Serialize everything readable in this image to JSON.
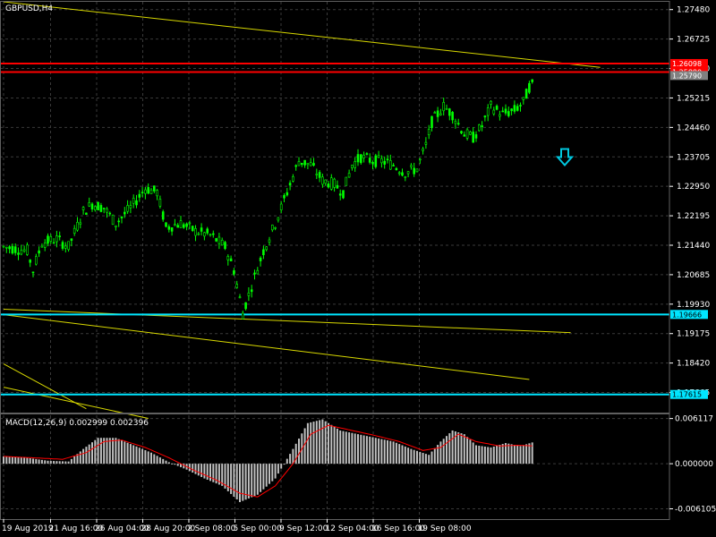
{
  "header": {
    "symbol": "GBPUSD,H4"
  },
  "macd_header": {
    "text": "MACD(12,26,9) 0.002999 0.002396"
  },
  "colors": {
    "background": "#000000",
    "grid": "#3a3a3a",
    "candles": "#00ff00",
    "trendline": "#d8d800",
    "resistance": "#ff0000",
    "support": "#00e5ff",
    "macd_hist": "#c0c0c0",
    "macd_signal": "#ff0000",
    "arrow": "#00c8e0"
  },
  "chart_data": [
    {
      "type": "line",
      "title": "GBPUSD,H4",
      "y_ticks": [
        "1.27480",
        "1.26725",
        "1.25970",
        "1.25215",
        "1.24460",
        "1.23705",
        "1.22950",
        "1.22195",
        "1.21440",
        "1.20685",
        "1.19930",
        "1.19175",
        "1.18420",
        "1.17665"
      ],
      "ylim": [
        1.1715,
        1.2768
      ],
      "x_ticks": [
        "19 Aug 2019",
        "21 Aug 16:00",
        "26 Aug 04:00",
        "28 Aug 20:00",
        "2 Sep 08:00",
        "5 Sep 00:00",
        "9 Sep 12:00",
        "12 Sep 04:00",
        "16 Sep 16:00",
        "19 Sep 08:00"
      ],
      "bars_total": 180,
      "price_path": [
        [
          0,
          1.214
        ],
        [
          8,
          1.213
        ],
        [
          10,
          1.208
        ],
        [
          13,
          1.215
        ],
        [
          18,
          1.216
        ],
        [
          22,
          1.214
        ],
        [
          27,
          1.223
        ],
        [
          30,
          1.225
        ],
        [
          34,
          1.224
        ],
        [
          38,
          1.22
        ],
        [
          43,
          1.224
        ],
        [
          48,
          1.229
        ],
        [
          52,
          1.228
        ],
        [
          55,
          1.219
        ],
        [
          60,
          1.22
        ],
        [
          65,
          1.218
        ],
        [
          70,
          1.217
        ],
        [
          75,
          1.214
        ],
        [
          78,
          1.208
        ],
        [
          81,
          1.197
        ],
        [
          84,
          1.204
        ],
        [
          88,
          1.213
        ],
        [
          92,
          1.22
        ],
        [
          96,
          1.228
        ],
        [
          100,
          1.236
        ],
        [
          104,
          1.235
        ],
        [
          108,
          1.231
        ],
        [
          112,
          1.23
        ],
        [
          115,
          1.228
        ],
        [
          118,
          1.235
        ],
        [
          121,
          1.237
        ],
        [
          125,
          1.236
        ],
        [
          128,
          1.236
        ],
        [
          132,
          1.235
        ],
        [
          136,
          1.233
        ],
        [
          140,
          1.234
        ],
        [
          143,
          1.24
        ],
        [
          145,
          1.246
        ],
        [
          149,
          1.25
        ],
        [
          152,
          1.248
        ],
        [
          156,
          1.243
        ],
        [
          159,
          1.242
        ],
        [
          162,
          1.245
        ],
        [
          165,
          1.25
        ],
        [
          169,
          1.248
        ],
        [
          173,
          1.249
        ],
        [
          176,
          1.251
        ],
        [
          178,
          1.255
        ],
        [
          180,
          1.256
        ]
      ],
      "horizontal_levels": [
        {
          "price": 1.26098,
          "label": "1.26098",
          "color": "#ff0000"
        },
        {
          "price": 1.2588,
          "label": "1.25880",
          "color": "#ff0000"
        },
        {
          "price": 1.2579,
          "label": "1.25790",
          "color": "#808080"
        },
        {
          "price": 1.19666,
          "label": "1.19666",
          "color": "#00e5ff"
        },
        {
          "price": 1.17615,
          "label": "1.17615",
          "color": "#00e5ff"
        }
      ],
      "trendlines": [
        {
          "from": [
            0,
            1.2768
          ],
          "to": [
            202,
            1.26
          ]
        },
        {
          "from": [
            0,
            1.198
          ],
          "to": [
            192,
            1.192
          ]
        },
        {
          "from": [
            0,
            1.1966
          ],
          "to": [
            178,
            1.18
          ]
        },
        {
          "from": [
            0,
            1.184
          ],
          "to": [
            28,
            1.1725
          ]
        },
        {
          "from": [
            0,
            1.178
          ],
          "to": [
            49,
            1.17
          ]
        }
      ],
      "arrow": {
        "type": "down",
        "bar": 190,
        "price": 1.237
      }
    },
    {
      "type": "bar",
      "title": "MACD(12,26,9) 0.002999 0.002396",
      "y_ticks": [
        "0.006117",
        "0.000000",
        "-0.006105"
      ],
      "ylim": [
        -0.0075,
        0.0068
      ],
      "macd_path": [
        [
          0,
          0.001
        ],
        [
          8,
          0.0008
        ],
        [
          15,
          0.0004
        ],
        [
          22,
          0.0003
        ],
        [
          27,
          0.002
        ],
        [
          32,
          0.0035
        ],
        [
          38,
          0.0035
        ],
        [
          44,
          0.0025
        ],
        [
          50,
          0.0015
        ],
        [
          56,
          0.0002
        ],
        [
          62,
          -0.0008
        ],
        [
          68,
          -0.002
        ],
        [
          74,
          -0.003
        ],
        [
          80,
          -0.0052
        ],
        [
          86,
          -0.0042
        ],
        [
          92,
          -0.002
        ],
        [
          98,
          0.002
        ],
        [
          103,
          0.0055
        ],
        [
          108,
          0.006
        ],
        [
          114,
          0.0045
        ],
        [
          120,
          0.004
        ],
        [
          126,
          0.0035
        ],
        [
          132,
          0.003
        ],
        [
          138,
          0.002
        ],
        [
          144,
          0.0012
        ],
        [
          148,
          0.003
        ],
        [
          152,
          0.0045
        ],
        [
          156,
          0.004
        ],
        [
          160,
          0.0025
        ],
        [
          165,
          0.0022
        ],
        [
          170,
          0.0028
        ],
        [
          175,
          0.0024
        ],
        [
          180,
          0.003
        ]
      ],
      "signal_path": [
        [
          0,
          0.001
        ],
        [
          10,
          0.0008
        ],
        [
          20,
          0.0006
        ],
        [
          28,
          0.0015
        ],
        [
          34,
          0.003
        ],
        [
          40,
          0.0032
        ],
        [
          48,
          0.0022
        ],
        [
          56,
          0.0008
        ],
        [
          64,
          -0.0008
        ],
        [
          72,
          -0.0022
        ],
        [
          80,
          -0.004
        ],
        [
          86,
          -0.0045
        ],
        [
          92,
          -0.003
        ],
        [
          98,
          0.0
        ],
        [
          104,
          0.004
        ],
        [
          110,
          0.0052
        ],
        [
          118,
          0.0045
        ],
        [
          126,
          0.0038
        ],
        [
          134,
          0.003
        ],
        [
          142,
          0.0018
        ],
        [
          148,
          0.0022
        ],
        [
          154,
          0.004
        ],
        [
          160,
          0.003
        ],
        [
          168,
          0.0024
        ],
        [
          174,
          0.0025
        ],
        [
          180,
          0.0024
        ]
      ]
    }
  ]
}
